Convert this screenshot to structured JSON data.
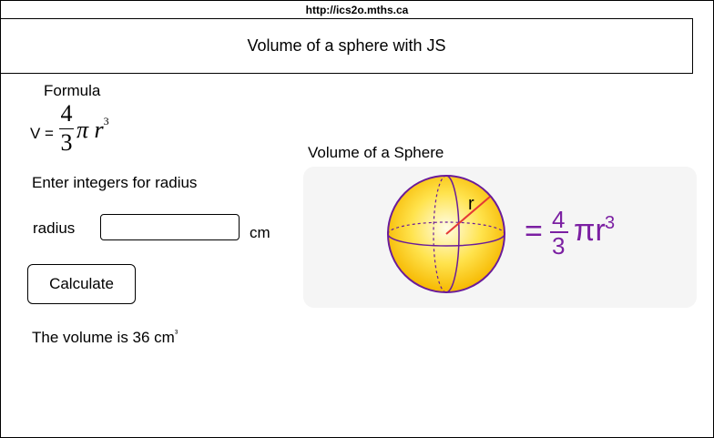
{
  "browser": {
    "url": "http://ics2o.mths.ca"
  },
  "header": {
    "title": "Volume of a sphere with JS"
  },
  "formula": {
    "label": "Formula",
    "lhs": "V =",
    "numerator": "4",
    "denominator": "3",
    "pi": "π",
    "r": "r",
    "exponent": "3"
  },
  "form": {
    "instructions": "Enter integers for radius",
    "radius_label": "radius",
    "radius_value": "",
    "unit": "cm",
    "calculate_label": "Calculate"
  },
  "result": {
    "text": "The volume is 36 cm",
    "superscript": "³"
  },
  "image": {
    "caption": "Volume of a Sphere",
    "radius_label": "r",
    "equals": "=",
    "numerator": "4",
    "denominator": "3",
    "pi_r": "πr",
    "exponent": "3",
    "formula_color": "#7b1fa2",
    "sphere_color": "#ffd600",
    "outline_color": "#6a1b9a",
    "radius_line_color": "#e53935"
  }
}
